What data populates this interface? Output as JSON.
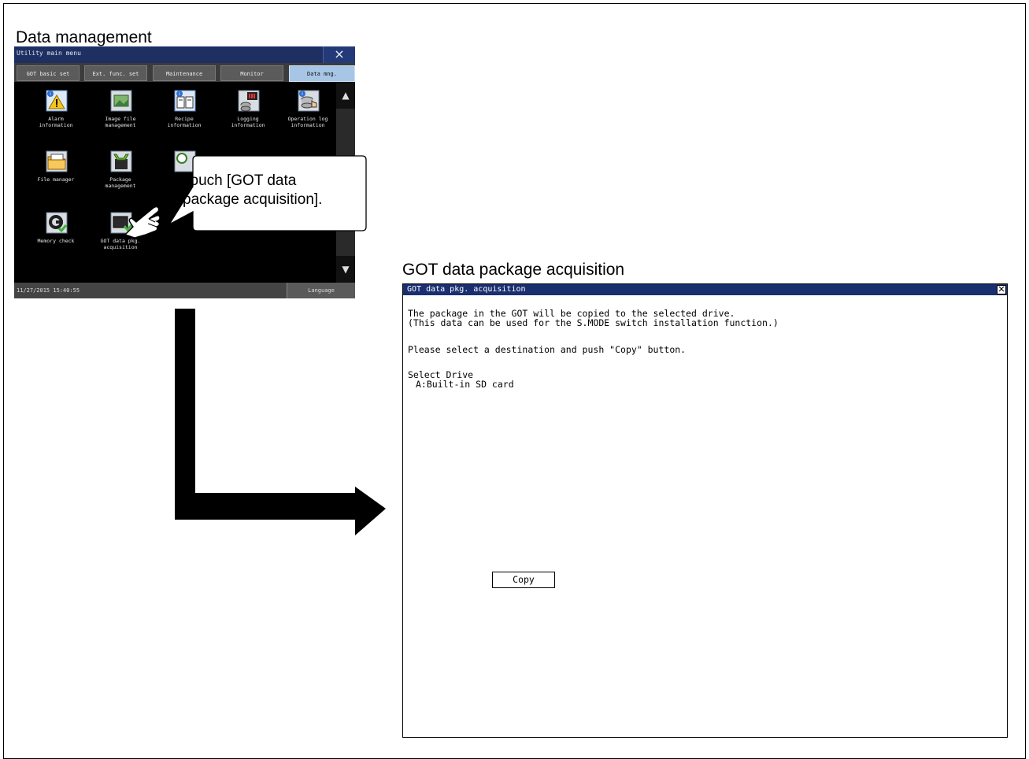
{
  "captions": {
    "left": "Data management",
    "right": "GOT data package acquisition"
  },
  "utility_menu": {
    "title": "Utility main menu",
    "close_glyph": "×",
    "tabs": [
      {
        "label": "GOT basic set",
        "active": false
      },
      {
        "label": "Ext. func. set",
        "active": false
      },
      {
        "label": "Maintenance",
        "active": false
      },
      {
        "label": "Monitor",
        "active": false
      },
      {
        "label": "Data mng.",
        "active": true
      }
    ],
    "icons": [
      {
        "line1": "Alarm",
        "line2": "information",
        "icon": "alarm-info-icon"
      },
      {
        "line1": "Image file",
        "line2": "management",
        "icon": "image-file-icon"
      },
      {
        "line1": "Recipe",
        "line2": "information",
        "icon": "recipe-info-icon"
      },
      {
        "line1": "Logging",
        "line2": "information",
        "icon": "logging-info-icon"
      },
      {
        "line1": "Operation log",
        "line2": "information",
        "icon": "operation-log-icon"
      },
      {
        "line1": "File manager",
        "line2": "",
        "icon": "file-manager-icon"
      },
      {
        "line1": "Package",
        "line2": "management",
        "icon": "package-management-icon"
      },
      {
        "line1": "Memory check",
        "line2": "",
        "icon": "memory-check-icon"
      },
      {
        "line1": "GOT data pkg.",
        "line2": "acquisition",
        "icon": "got-data-pkg-icon"
      }
    ],
    "status_time": "11/27/2015 15:40:55",
    "language_label": "Language",
    "scroll_up": "▲",
    "scroll_down": "▼"
  },
  "callout": {
    "line1": "Touch [GOT data",
    "line2": "package acquisition]."
  },
  "dialog": {
    "title": "GOT data pkg. acquisition",
    "close_glyph": "✕",
    "desc_line1": "The package in the GOT will be copied to the selected drive.",
    "desc_line2": "(This data can be used for the S.MODE switch installation function.)",
    "instruction": "Please select a destination and push \"Copy\" button.",
    "select_drive_label": "Select Drive",
    "drive_option": "A:Built-in SD card",
    "copy_button": "Copy"
  },
  "colors": {
    "got_title_bar": "#1e2f62",
    "active_tab": "#a7c6e6",
    "dialog_title_bar": "#1a2f70"
  }
}
